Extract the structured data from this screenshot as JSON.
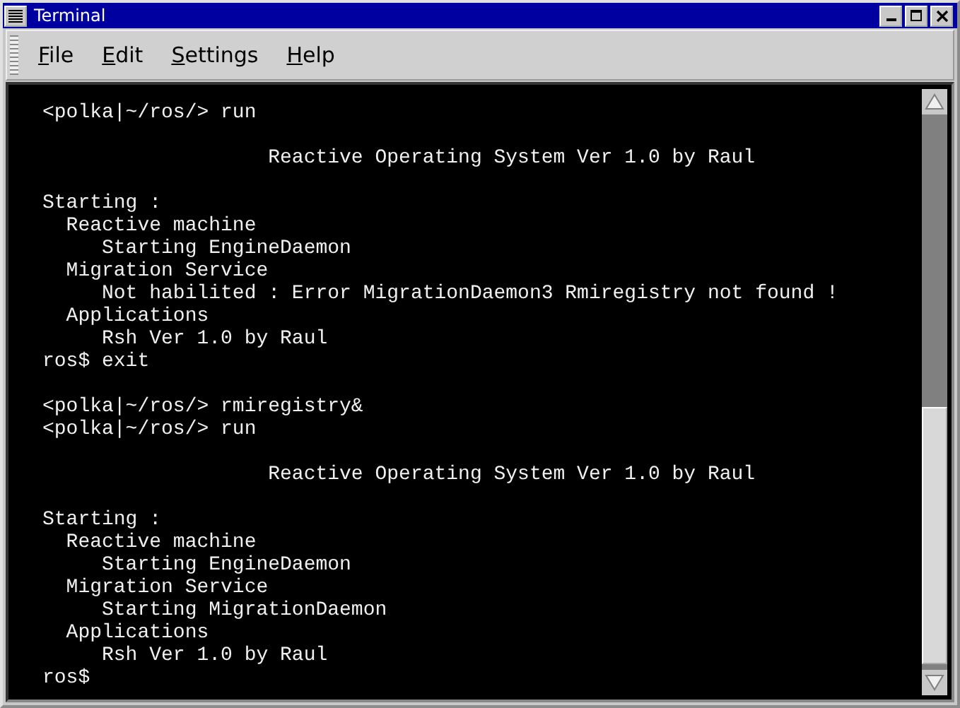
{
  "window": {
    "title": "Terminal"
  },
  "menu": [
    "File",
    "Edit",
    "Settings",
    "Help"
  ],
  "terminal": {
    "blocks": [
      [
        "<polka|~/ros/> run"
      ],
      [
        "                   Reactive Operating System Ver 1.0 by Raul"
      ],
      [
        "Starting :",
        "  Reactive machine",
        "     Starting EngineDaemon",
        "  Migration Service",
        "     Not habilited : Error MigrationDaemon3 Rmiregistry not found !",
        "  Applications",
        "     Rsh Ver 1.0 by Raul",
        "ros$ exit"
      ],
      [
        "<polka|~/ros/> rmiregistry&",
        "<polka|~/ros/> run"
      ],
      [
        "                   Reactive Operating System Ver 1.0 by Raul"
      ],
      [
        "Starting :",
        "  Reactive machine",
        "     Starting EngineDaemon",
        "  Migration Service",
        "     Starting MigrationDaemon",
        "  Applications",
        "     Rsh Ver 1.0 by Raul",
        "ros$"
      ]
    ]
  }
}
